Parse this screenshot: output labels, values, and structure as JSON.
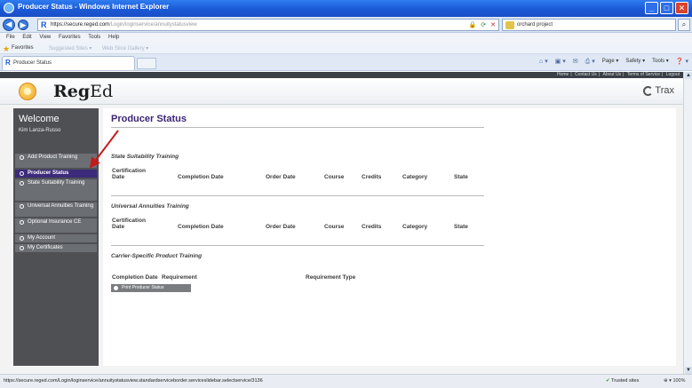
{
  "browser": {
    "window_title": "Producer Status - Windows Internet Explorer",
    "address_host": "https://secure.reged.com",
    "address_path": "/Login/loginservice/annuitystatusview",
    "search_value": "orchard project",
    "menu": [
      "File",
      "Edit",
      "View",
      "Favorites",
      "Tools",
      "Help"
    ],
    "favorites_label": "Favorites",
    "favorites_ghost": [
      "Suggested Sites ▾",
      "Web Slice Gallery ▾"
    ],
    "tab_label": "Producer Status",
    "commands": [
      "Page ▾",
      "Safety ▾",
      "Tools ▾"
    ],
    "status_url": "https://secure.reged.com/Login/loginservice/annuitystatusview.standardserviceborder.serviceslidebar.selectservice/3136",
    "status_zone": "Trusted sites",
    "status_zoom": "100%"
  },
  "site": {
    "top_links": [
      "Home",
      "Contact Us",
      "About Us",
      "Terms of Service",
      "Logout"
    ],
    "logo_reg": "Reg",
    "logo_ed": "Ed",
    "trax": "Trax"
  },
  "sidebar": {
    "welcome": "Welcome",
    "user": "Kim Lanza-Russo",
    "items": [
      {
        "label": "Add Product Training"
      },
      {
        "label": "Producer Status"
      },
      {
        "label": "State Suitability Training"
      },
      {
        "label": "Universal Annuities Training"
      },
      {
        "label": "Optional Insurance CE"
      },
      {
        "label": "My Account"
      },
      {
        "label": "My Certificates"
      }
    ]
  },
  "main": {
    "title": "Producer Status",
    "section1": {
      "title": "State Suitability Training",
      "headers": [
        "Certification Date",
        "Completion Date",
        "Order Date",
        "Course",
        "Credits",
        "Category",
        "State"
      ]
    },
    "section2": {
      "title": "Universal Annuities Training",
      "headers": [
        "Certification Date",
        "Completion Date",
        "Order Date",
        "Course",
        "Credits",
        "Category",
        "State"
      ]
    },
    "section3": {
      "title": "Carrier-Specific Product Training",
      "headers": [
        "Completion Date",
        "Requirement",
        "Requirement Type"
      ]
    },
    "print_button": "Print Producer Status"
  }
}
